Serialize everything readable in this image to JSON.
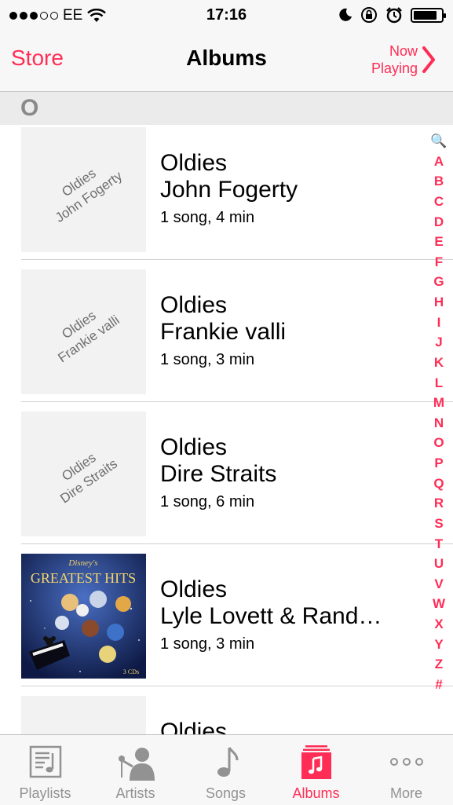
{
  "status": {
    "carrier": "EE",
    "time": "17:16",
    "battery_level": 0.85,
    "signal_bars_filled": 3
  },
  "nav": {
    "back_label": "Store",
    "title": "Albums",
    "now_playing": [
      "Now",
      "Playing"
    ]
  },
  "section_header": "O",
  "albums": [
    {
      "title": "Oldies",
      "artist": "John Fogerty",
      "meta": "1 song, 4 min",
      "placeholder": [
        "Oldies",
        "John Fogerty"
      ]
    },
    {
      "title": "Oldies",
      "artist": "Frankie valli",
      "meta": "1 song, 3 min",
      "placeholder": [
        "Oldies",
        "Frankie valli"
      ]
    },
    {
      "title": "Oldies",
      "artist": "Dire Straits",
      "meta": "1 song, 6 min",
      "placeholder": [
        "Oldies",
        "Dire Straits"
      ]
    },
    {
      "title": "Oldies",
      "artist": "Lyle Lovett & Rand…",
      "meta": "1 song, 3 min",
      "artwork": {
        "brand": "Disney's",
        "title": "GREATEST HITS",
        "sub": "3 CDs"
      }
    },
    {
      "title": "Oldies"
    }
  ],
  "index": [
    "🔍",
    "A",
    "B",
    "C",
    "D",
    "E",
    "F",
    "G",
    "H",
    "I",
    "J",
    "K",
    "L",
    "M",
    "N",
    "O",
    "P",
    "Q",
    "R",
    "S",
    "T",
    "U",
    "V",
    "W",
    "X",
    "Y",
    "Z",
    "#"
  ],
  "tabs": [
    {
      "label": "Playlists",
      "icon": "playlists-icon"
    },
    {
      "label": "Artists",
      "icon": "artists-icon"
    },
    {
      "label": "Songs",
      "icon": "songs-icon"
    },
    {
      "label": "Albums",
      "icon": "albums-icon",
      "active": true
    },
    {
      "label": "More",
      "icon": "more-icon"
    }
  ],
  "colors": {
    "accent": "#ff2d55",
    "inactive": "#929292"
  }
}
